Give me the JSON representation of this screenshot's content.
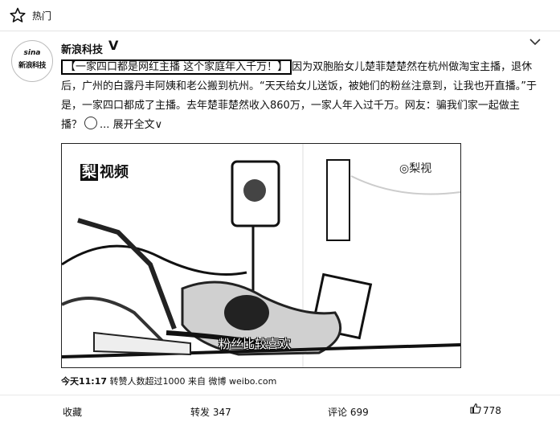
{
  "header": {
    "title": "热门"
  },
  "author": {
    "avatar_line1": "sina",
    "avatar_line2": "新浪科技",
    "name": "新浪科技",
    "verified_mark": "V"
  },
  "post": {
    "headline": "【一家四口都是网红主播 这个家庭年入千万！】",
    "body": "因为双胞胎女儿楚菲楚楚然在杭州做淘宝主播，退休后，广州的白露丹丰阿姨和老公搬到杭州。“天天给女儿送饭，被她们的粉丝注意到，让我也开直播。”于是，一家四口都成了主播。去年楚菲楚然收入860万，一家人年入过千万。网友：骗我们家一起做主播？",
    "ellipsis": "...",
    "expand_label": "展开全文∨"
  },
  "video": {
    "logo_left": "视频",
    "logo_left_mark": "梨",
    "logo_right": "◎梨视",
    "subtitle": "粉丝比较喜欢"
  },
  "meta": {
    "time": "今天11:17",
    "info": "转赞人数超过1000 来自 微博 weibo.com"
  },
  "actions": {
    "collect": "收藏",
    "repost": "转发 347",
    "comment": "评论 699",
    "like": "778"
  }
}
